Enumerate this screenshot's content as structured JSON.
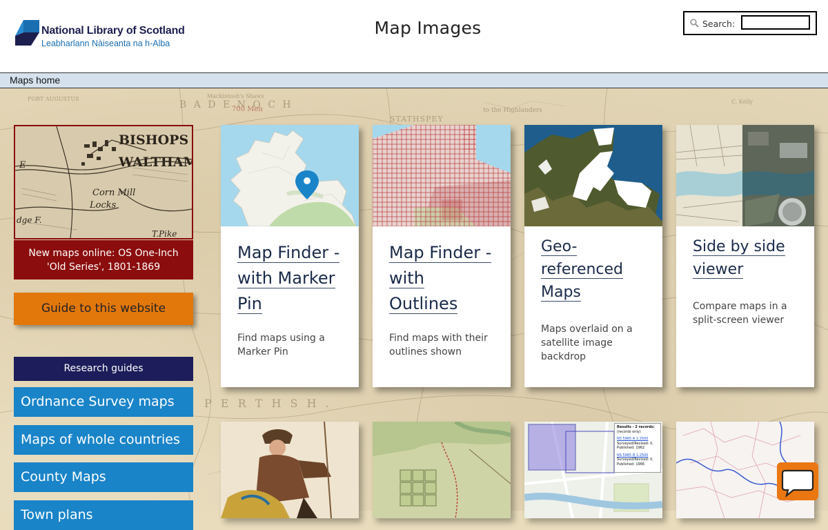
{
  "header": {
    "logo_name": "National Library of Scotland",
    "logo_gaelic": "Leabharlann Nàiseanta na h-Alba",
    "page_title": "Map Images",
    "search_label": "Search:",
    "search_value": ""
  },
  "nav": {
    "maps_home": "Maps home"
  },
  "background_map": {
    "labels": [
      "B A D E N O C H",
      "STATHSPEY",
      "P E R T H  S H .",
      "FORT AUGUSTUS",
      "700 Men",
      "Mackintosh's Shaws",
      "to the Highlanders",
      "C. Kelly"
    ]
  },
  "feature": {
    "map_labels": [
      "BISHOPS",
      "WALTHAM",
      "Corn Mill",
      "Locks",
      "T.Pike",
      "E",
      "dge F."
    ],
    "caption_line1": "New maps online: OS One-Inch",
    "caption_line2": "'Old Series', 1801-1869"
  },
  "guide_button": "Guide to this website",
  "research_guides": {
    "heading": "Research guides",
    "items": [
      "Ordnance Survey maps",
      "Maps of whole countries",
      "County Maps",
      "Town plans"
    ]
  },
  "cards": [
    {
      "title": [
        "Map Finder -",
        "with Marker",
        "Pin"
      ],
      "desc": [
        "Find maps using a",
        "Marker Pin"
      ]
    },
    {
      "title": [
        "Map Finder -",
        "with",
        "Outlines"
      ],
      "desc": [
        "Find maps with their",
        "outlines shown"
      ]
    },
    {
      "title": [
        "Geo-",
        "referenced",
        "Maps"
      ],
      "desc": [
        "Maps overlaid on a",
        "satellite image",
        "backdrop"
      ]
    },
    {
      "title": [
        "Side by side",
        "viewer"
      ],
      "desc": [
        "Compare maps in a",
        "split-screen viewer"
      ]
    }
  ],
  "results_panel": {
    "heading": "Results - 2 records:",
    "subheading": "(records only)",
    "entries": [
      {
        "link": "NS 5965 A 1:2500",
        "line1": "Surveyed/Revised: 0,",
        "line2": "Published: 1962"
      },
      {
        "link": "NS 5965 B 1:2500",
        "line1": "Surveyed/Revised: 0,",
        "line2": "Published: 1966"
      }
    ]
  },
  "colors": {
    "brand_navy": "#1c1d5a",
    "feature_red": "#8b0d0d",
    "guide_orange": "#e2780c",
    "research_blue": "#1a84c8",
    "nav_blue": "#d5e2ee"
  }
}
